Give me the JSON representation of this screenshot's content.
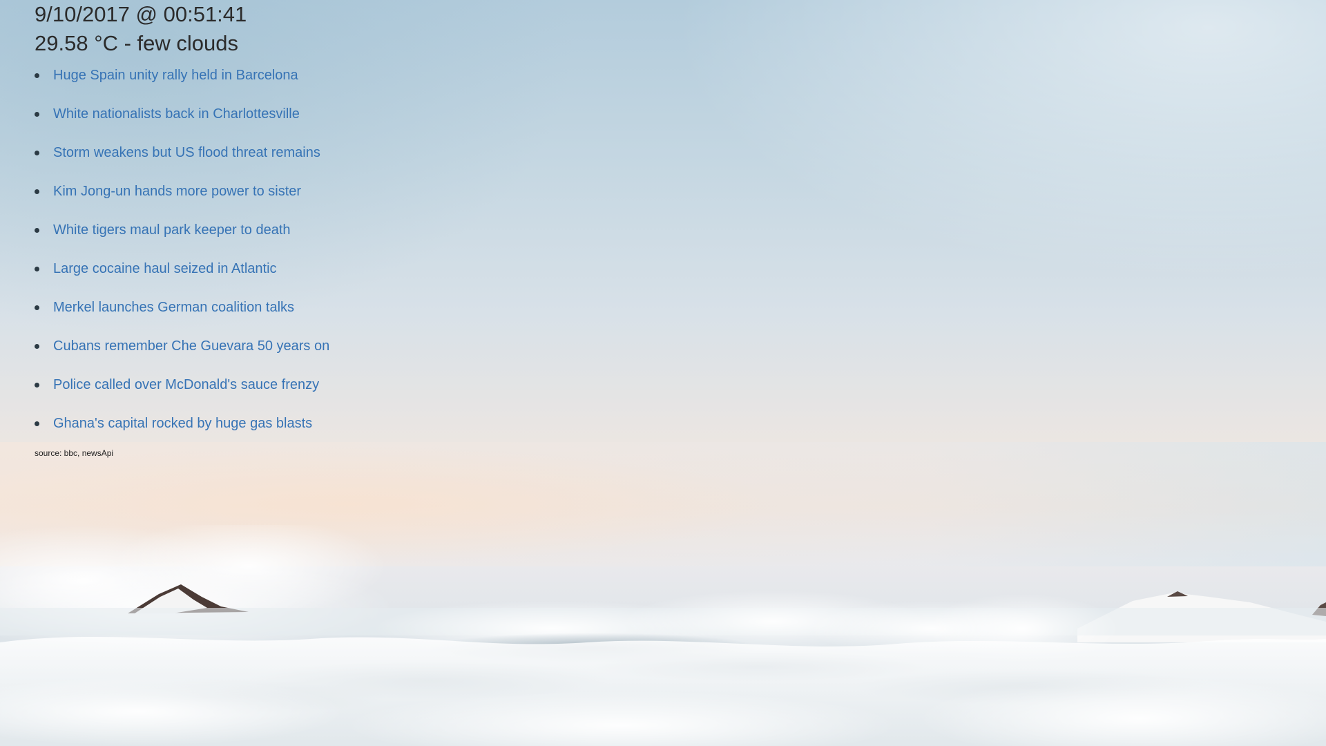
{
  "header": {
    "datetime": "9/10/2017 @ 00:51:41",
    "weather": "29.58 °C - few clouds"
  },
  "news": [
    {
      "title": "Huge Spain unity rally held in Barcelona"
    },
    {
      "title": "White nationalists back in Charlottesville"
    },
    {
      "title": "Storm weakens but US flood threat remains"
    },
    {
      "title": "Kim Jong-un hands more power to sister"
    },
    {
      "title": "White tigers maul park keeper to death"
    },
    {
      "title": "Large cocaine haul seized in Atlantic"
    },
    {
      "title": "Merkel launches German coalition talks"
    },
    {
      "title": "Cubans remember Che Guevara 50 years on"
    },
    {
      "title": "Police called over McDonald's sauce frenzy"
    },
    {
      "title": "Ghana's capital rocked by huge gas blasts"
    }
  ],
  "footer": {
    "source": "source: bbc, newsApi"
  },
  "colors": {
    "link": "#3673b5",
    "text": "#2b2b2b"
  }
}
